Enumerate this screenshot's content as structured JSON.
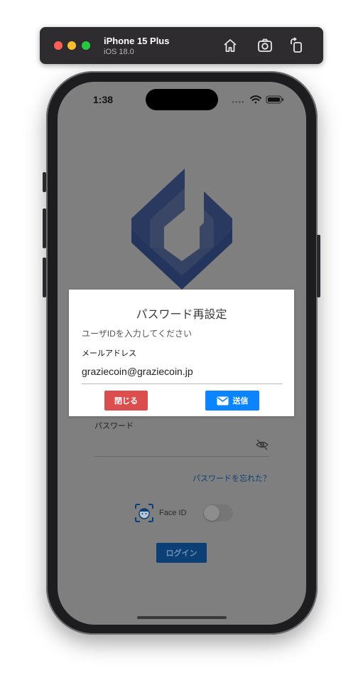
{
  "simulator": {
    "device_name": "iPhone 15 Plus",
    "os_version": "iOS 18.0",
    "icons": [
      "home-icon",
      "screenshot-icon",
      "rotate-icon"
    ]
  },
  "status_bar": {
    "time": "1:38"
  },
  "login_screen": {
    "password_label": "パスワード",
    "forgot_password_link": "パスワードを忘れた？",
    "face_id_label": "Face ID",
    "face_id_enabled": false,
    "login_button": "ログイン"
  },
  "modal": {
    "title": "パスワード再設定",
    "message": "ユーザIDを入力してください",
    "email_label": "メールアドレス",
    "email_value": "graziecoin@graziecoin.jp",
    "close_button": "閉じる",
    "send_button": "送信"
  },
  "colors": {
    "brand_navy": "#0b3f75",
    "logo_navy": "#1b2d5a",
    "send_blue": "#0a84ff",
    "close_red": "#dc4e4e",
    "overlay_gray": "#7f7f7f"
  }
}
